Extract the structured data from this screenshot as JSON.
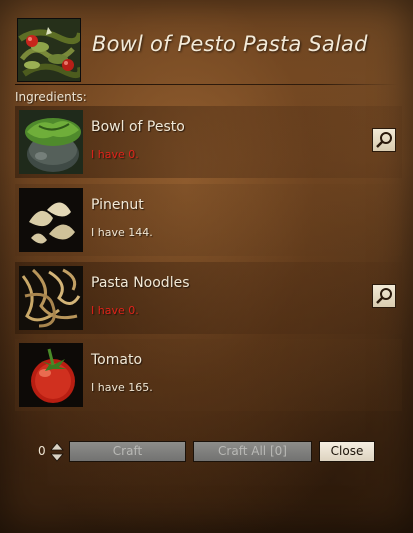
{
  "recipe": {
    "title": "Bowl of Pesto Pasta Salad",
    "icon": "pesto-pasta-salad-icon"
  },
  "ingredients_label": "Ingredients:",
  "ingredients": [
    {
      "name": "Bowl of Pesto",
      "status": "I have 0.",
      "missing": true,
      "icon": "bowl-of-pesto-icon",
      "has_search": true
    },
    {
      "name": "Pinenut",
      "status": "I have 144.",
      "missing": false,
      "icon": "pinenut-icon",
      "has_search": false
    },
    {
      "name": "Pasta Noodles",
      "status": "I have 0.",
      "missing": true,
      "icon": "pasta-noodles-icon",
      "has_search": true
    },
    {
      "name": "Tomato",
      "status": "I have 165.",
      "missing": false,
      "icon": "tomato-icon",
      "has_search": false
    }
  ],
  "footer": {
    "quantity": "0",
    "craft_label": "Craft",
    "craft_all_label": "Craft All [0]",
    "close_label": "Close"
  },
  "colors": {
    "missing": "#e0231a",
    "text": "#f1e8d6"
  }
}
